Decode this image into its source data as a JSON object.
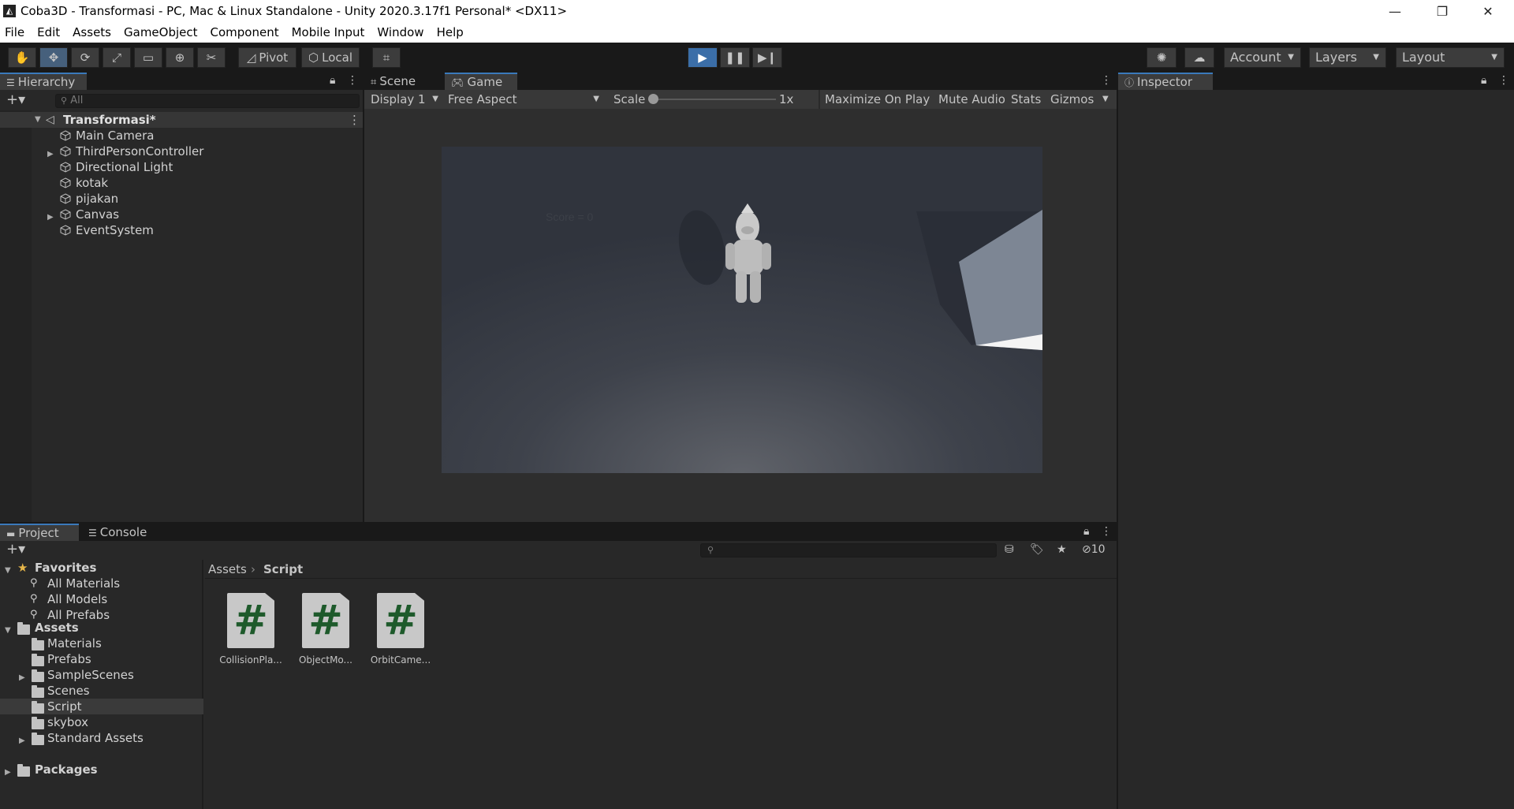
{
  "window": {
    "title": "Coba3D - Transformasi - PC, Mac & Linux Standalone - Unity 2020.3.17f1 Personal* <DX11>"
  },
  "menu": [
    "File",
    "Edit",
    "Assets",
    "GameObject",
    "Component",
    "Mobile Input",
    "Window",
    "Help"
  ],
  "toolbar": {
    "pivot_label": "Pivot",
    "local_label": "Local",
    "account_label": "Account",
    "layers_label": "Layers",
    "layout_label": "Layout"
  },
  "hierarchy": {
    "tab_label": "Hierarchy",
    "search_placeholder": "All",
    "scene_name": "Transformasi*",
    "items": [
      {
        "label": "Main Camera",
        "expandable": false
      },
      {
        "label": "ThirdPersonController",
        "expandable": true
      },
      {
        "label": "Directional Light",
        "expandable": false
      },
      {
        "label": "kotak",
        "expandable": false
      },
      {
        "label": "pijakan",
        "expandable": false
      },
      {
        "label": "Canvas",
        "expandable": true
      },
      {
        "label": "EventSystem",
        "expandable": false
      }
    ]
  },
  "center": {
    "tabs": [
      "Scene",
      "Game"
    ],
    "selected_tab": "Game",
    "display_label": "Display 1",
    "aspect_label": "Free Aspect",
    "scale_label": "Scale",
    "scale_value": "1x",
    "maximize_label": "Maximize On Play",
    "mute_label": "Mute Audio",
    "stats_label": "Stats",
    "gizmos_label": "Gizmos",
    "game_score_text": "Score = 0"
  },
  "inspector": {
    "tab_label": "Inspector"
  },
  "project": {
    "tabs": [
      "Project",
      "Console"
    ],
    "hidden_count": "10",
    "favorites_label": "Favorites",
    "favorites": [
      "All Materials",
      "All Models",
      "All Prefabs"
    ],
    "assets_label": "Assets",
    "asset_folders": [
      {
        "label": "Materials",
        "expandable": false
      },
      {
        "label": "Prefabs",
        "expandable": false
      },
      {
        "label": "SampleScenes",
        "expandable": true
      },
      {
        "label": "Scenes",
        "expandable": false
      },
      {
        "label": "Script",
        "expandable": false,
        "selected": true
      },
      {
        "label": "skybox",
        "expandable": false
      },
      {
        "label": "Standard Assets",
        "expandable": true
      }
    ],
    "packages_label": "Packages",
    "breadcrumb": [
      "Assets",
      "Script"
    ],
    "files": [
      "CollisionPla...",
      "ObjectMo...",
      "OrbitCame..."
    ],
    "file_glyph": "#"
  },
  "colors": {
    "accent": "#3a79bb",
    "script_icon_fg": "#1e5a2b",
    "script_icon_bg": "#c8c8c8"
  }
}
